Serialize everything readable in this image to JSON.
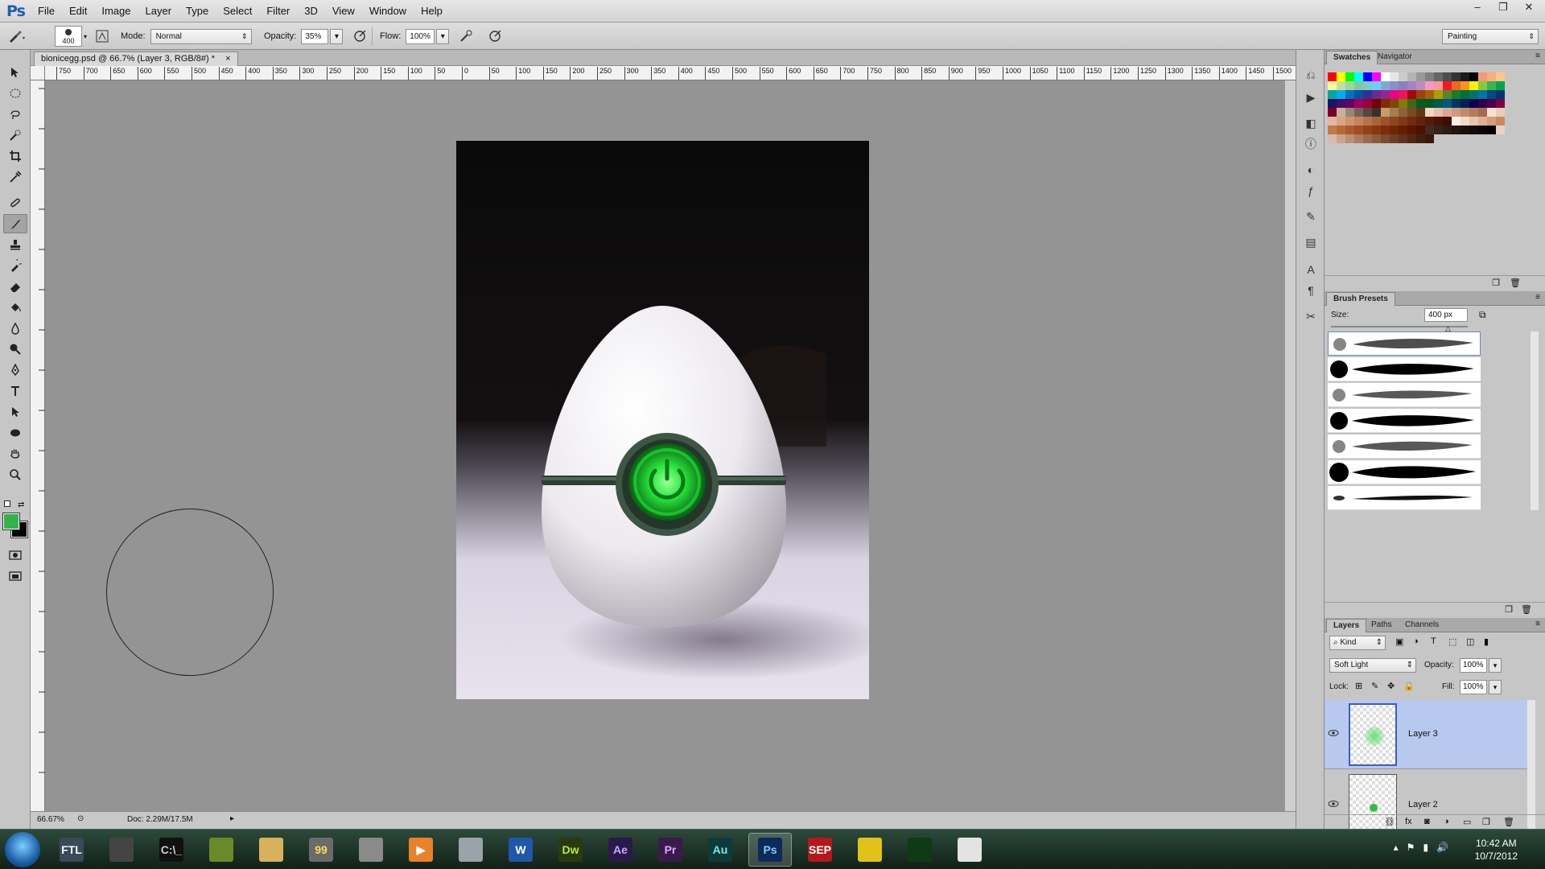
{
  "app": {
    "logo": "Ps",
    "menu": [
      "File",
      "Edit",
      "Image",
      "Layer",
      "Type",
      "Select",
      "Filter",
      "3D",
      "View",
      "Window",
      "Help"
    ],
    "window_controls": [
      "–",
      "❐",
      "✕"
    ]
  },
  "options_bar": {
    "brush_size": "400",
    "mode_label": "Mode:",
    "mode_value": "Normal",
    "opacity_label": "Opacity:",
    "opacity_value": "35%",
    "flow_label": "Flow:",
    "flow_value": "100%",
    "workspace": "Painting"
  },
  "document": {
    "tab_title": "bionicegg.psd @ 66.7% (Layer 3, RGB/8#) *",
    "tab_close": "×",
    "ruler_labels": [
      "750",
      "700",
      "650",
      "600",
      "550",
      "500",
      "450",
      "400",
      "350",
      "300",
      "250",
      "200",
      "150",
      "100",
      "50",
      "0",
      "50",
      "100",
      "150",
      "200",
      "250",
      "300",
      "350",
      "400",
      "450",
      "500",
      "550",
      "600",
      "650",
      "700",
      "750",
      "800",
      "850",
      "900",
      "950",
      "1000",
      "1050",
      "1100",
      "1150",
      "1200",
      "1250",
      "1300",
      "1350",
      "1400",
      "1450",
      "1500"
    ],
    "zoom": "66.67%",
    "doc_size": "Doc: 2.29M/17.5M"
  },
  "swatches_panel": {
    "tabs": [
      "Swatches",
      "Navigator"
    ],
    "colors": [
      "#ff0000",
      "#ffff00",
      "#00ff00",
      "#00ffff",
      "#0000ff",
      "#ff00ff",
      "#ffffff",
      "#e6e6e6",
      "#cccccc",
      "#b3b3b3",
      "#999999",
      "#808080",
      "#666666",
      "#4d4d4d",
      "#333333",
      "#1a1a1a",
      "#000000",
      "#f7977a",
      "#f9ad81",
      "#fdc68a",
      "#fff79a",
      "#c4df9b",
      "#a2d39c",
      "#82ca9d",
      "#7bcdc8",
      "#6ecff6",
      "#7ea7d8",
      "#8493ca",
      "#8882be",
      "#a187be",
      "#bc8dbf",
      "#f49ac2",
      "#f6989d",
      "#ed1c24",
      "#f26522",
      "#f7941d",
      "#fff200",
      "#8dc73f",
      "#39b54a",
      "#00a651",
      "#00a99d",
      "#00aeef",
      "#0072bc",
      "#0054a6",
      "#2e3192",
      "#662d91",
      "#92278f",
      "#ec008c",
      "#ed145b",
      "#9e0b0f",
      "#a0410d",
      "#a36209",
      "#aba000",
      "#598527",
      "#1a7b30",
      "#007236",
      "#00746b",
      "#0076a3",
      "#004b80",
      "#003471",
      "#1b1464",
      "#440e62",
      "#630460",
      "#9e005d",
      "#9e0039",
      "#790000",
      "#7b2e00",
      "#7d4900",
      "#827b00",
      "#406618",
      "#005e20",
      "#005826",
      "#005952",
      "#005b7f",
      "#003663",
      "#002157",
      "#0d004c",
      "#32004b",
      "#4b0049",
      "#7b0046",
      "#7a0026",
      "#c7b299",
      "#998675",
      "#736357",
      "#534741",
      "#37302d",
      "#c69c6d",
      "#a67c52",
      "#8c6239",
      "#754c24",
      "#603913",
      "#f2d5c3",
      "#e8c0a8",
      "#dba98f",
      "#cf9a7e",
      "#c28a6d",
      "#b47a5c",
      "#a66c4f",
      "#f5e1d3",
      "#ecccb7",
      "#e3b89e",
      "#d9a586",
      "#cf9370",
      "#c5825c",
      "#b87249",
      "#aa6239",
      "#9c532b",
      "#8e4520",
      "#803817",
      "#722c10",
      "#65220b",
      "#581a08",
      "#4b1305",
      "#3f0d03",
      "#fbeee4",
      "#f2d9c8",
      "#e8c4ac",
      "#dfb091",
      "#d59d78",
      "#cb8b61",
      "#c17a4c",
      "#b66a3a",
      "#ab5b2b",
      "#a04e1f",
      "#944215",
      "#88370d",
      "#7c2d08",
      "#702504",
      "#641d02",
      "#581701",
      "#4c1100",
      "#402c22",
      "#35231b",
      "#2b1c15",
      "#22160f",
      "#1a100b",
      "#120b07",
      "#0b0604",
      "#050302",
      "#e7d2c4",
      "#d7bba8",
      "#c8a58e",
      "#b99076",
      "#aa7c60",
      "#9b6a4d",
      "#8c5a3d",
      "#7d4b30",
      "#6e3e25",
      "#60321b",
      "#522813",
      "#451f0c",
      "#381707"
    ]
  },
  "brush_presets_panel": {
    "tab": "Brush Presets",
    "size_label": "Size:",
    "size_value": "400 px"
  },
  "layers_panel": {
    "tabs": [
      "Layers",
      "Paths",
      "Channels"
    ],
    "filter_kind": "Kind",
    "blend_mode": "Soft Light",
    "opacity_label": "Opacity:",
    "opacity_value": "100%",
    "lock_label": "Lock:",
    "fill_label": "Fill:",
    "fill_value": "100%",
    "layers": [
      {
        "name": "Layer 3",
        "selected": true
      },
      {
        "name": "Layer 2",
        "selected": false
      },
      {
        "name": "",
        "selected": false
      }
    ]
  },
  "taskbar": {
    "apps": [
      {
        "name": "FTL",
        "color": "#3a4a5a",
        "text_color": "#ffffff"
      },
      {
        "name": "",
        "color": "#444444",
        "text_color": "#ffffff"
      },
      {
        "name": "C:\\_",
        "color": "#111111",
        "text_color": "#cfcfcf"
      },
      {
        "name": "",
        "color": "#6a8a2a",
        "text_color": "#ffffff"
      },
      {
        "name": "",
        "color": "#d8b25a",
        "text_color": "#ffffff"
      },
      {
        "name": "99",
        "color": "#6b6b6b",
        "text_color": "#ffdd55"
      },
      {
        "name": "",
        "color": "#8a8a8a",
        "text_color": "#ffffff"
      },
      {
        "name": "▶",
        "color": "#e8822a",
        "text_color": "#ffffff"
      },
      {
        "name": "",
        "color": "#9aa3aa",
        "text_color": "#ffffff"
      },
      {
        "name": "W",
        "color": "#1f58a8",
        "text_color": "#ffffff"
      },
      {
        "name": "Dw",
        "color": "#2a3a10",
        "text_color": "#b6ee3a"
      },
      {
        "name": "Ae",
        "color": "#2a1a4a",
        "text_color": "#c3a8ff"
      },
      {
        "name": "Pr",
        "color": "#3a1a4a",
        "text_color": "#e0a8ff"
      },
      {
        "name": "Au",
        "color": "#0e3a3a",
        "text_color": "#7ee6e0"
      },
      {
        "name": "Ps",
        "color": "#0c2a5a",
        "text_color": "#8cc8ff"
      },
      {
        "name": "SEP",
        "color": "#b3191c",
        "text_color": "#ffffff"
      },
      {
        "name": "",
        "color": "#e2c21a",
        "text_color": "#ffffff"
      },
      {
        "name": "",
        "color": "#0f3a14",
        "text_color": "#22dd44"
      },
      {
        "name": "",
        "color": "#e3e3e3",
        "text_color": "#ffffff"
      }
    ],
    "time": "10:42 AM",
    "date": "10/7/2012"
  }
}
